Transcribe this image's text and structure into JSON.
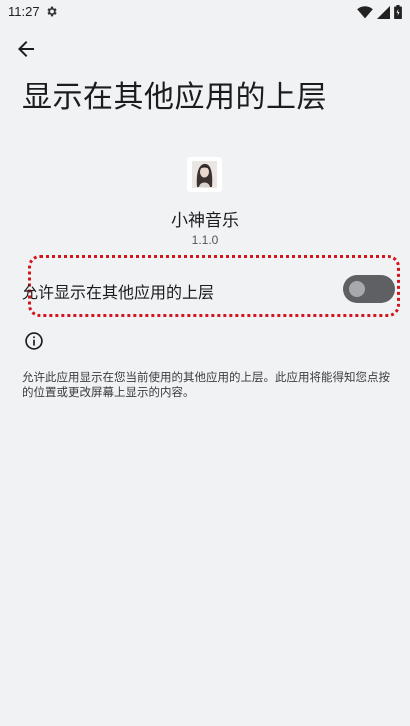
{
  "status_bar": {
    "time": "11:27",
    "icons": [
      "gear-icon",
      "wifi-icon",
      "signal-icon",
      "battery-icon"
    ]
  },
  "header": {
    "back_icon": "arrow-left-icon",
    "title": "显示在其他应用的上层"
  },
  "app": {
    "name": "小神音乐",
    "version": "1.1.0"
  },
  "permission": {
    "label": "允许显示在其他应用的上层",
    "enabled": false
  },
  "info": {
    "icon": "info-icon",
    "description": "允许此应用显示在您当前使用的其他应用的上层。此应用将能得知您点按的位置或更改屏幕上显示的内容。"
  },
  "colors": {
    "background": "#f1f2f4",
    "switch_track": "#5e6063",
    "switch_thumb": "#a7a9ad",
    "highlight": "#d4141c"
  }
}
